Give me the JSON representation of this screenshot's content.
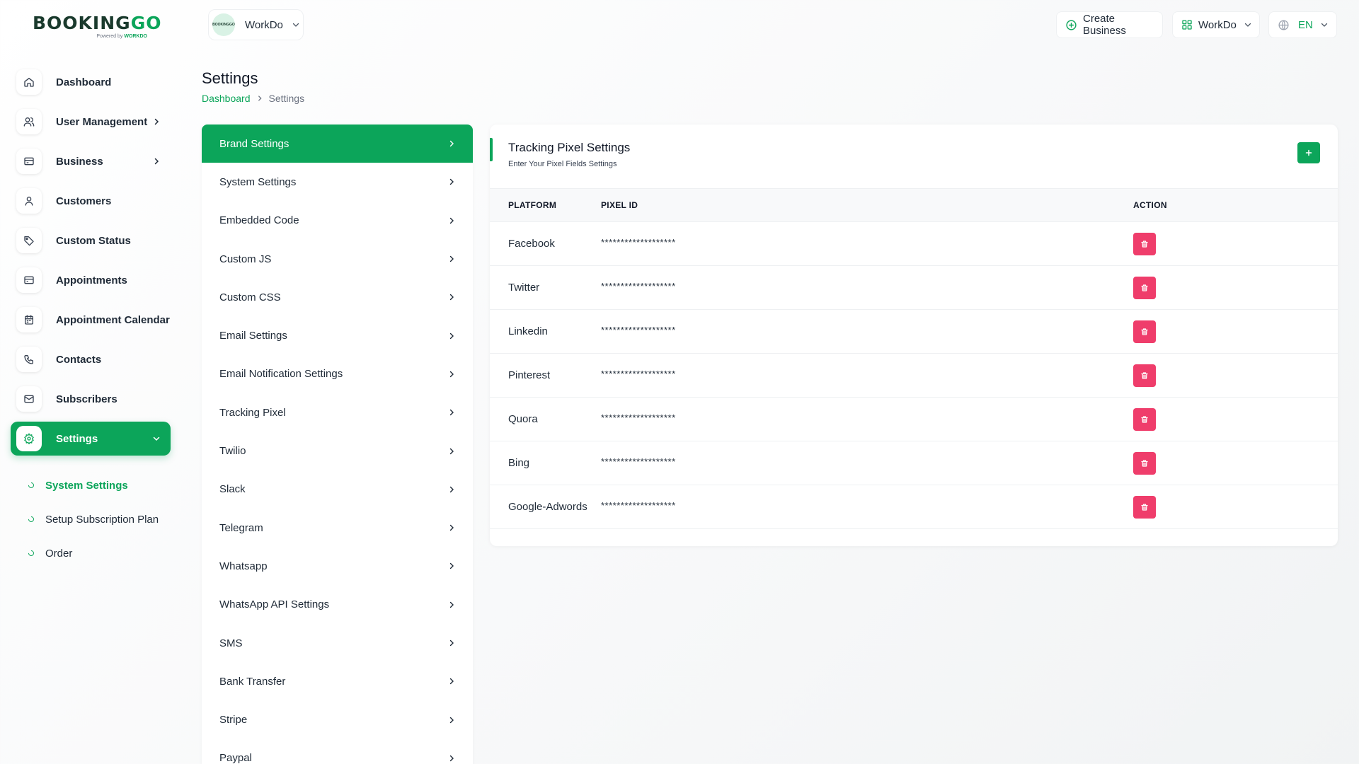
{
  "brand": {
    "logo_main": "BOOKING",
    "logo_accent": "GO",
    "logo_powered": "Powered by",
    "logo_powered_brand": "WORKDO"
  },
  "workspace": {
    "name": "WorkDo",
    "avatar_text": "BOOKINGGO"
  },
  "topbar": {
    "create_label": "Create Business",
    "workspace_label": "WorkDo",
    "language": "EN"
  },
  "sidebar": {
    "items": [
      {
        "label": "Dashboard",
        "icon": "home-icon"
      },
      {
        "label": "User Management",
        "icon": "users-icon"
      },
      {
        "label": "Business",
        "icon": "business-icon"
      },
      {
        "label": "Customers",
        "icon": "user-icon"
      },
      {
        "label": "Custom Status",
        "icon": "tag-icon"
      },
      {
        "label": "Appointments",
        "icon": "card-icon"
      },
      {
        "label": "Appointment Calendar",
        "icon": "calendar-icon"
      },
      {
        "label": "Contacts",
        "icon": "phone-icon"
      },
      {
        "label": "Subscribers",
        "icon": "mail-icon"
      },
      {
        "label": "Settings",
        "icon": "gear-icon"
      }
    ],
    "sub_items": [
      {
        "label": "System Settings"
      },
      {
        "label": "Setup Subscription Plan"
      },
      {
        "label": "Order"
      }
    ]
  },
  "page": {
    "title": "Settings",
    "breadcrumb_home": "Dashboard",
    "breadcrumb_current": "Settings"
  },
  "settings_menu": [
    "Brand Settings",
    "System Settings",
    "Embedded Code",
    "Custom JS",
    "Custom CSS",
    "Email Settings",
    "Email Notification Settings",
    "Tracking Pixel",
    "Twilio",
    "Slack",
    "Telegram",
    "Whatsapp",
    "WhatsApp API Settings",
    "SMS",
    "Bank Transfer",
    "Stripe",
    "Paypal"
  ],
  "tracking_card": {
    "title": "Tracking Pixel Settings",
    "subtitle": "Enter Your Pixel Fields Settings",
    "columns": {
      "platform": "PLATFORM",
      "pixel_id": "PIXEL ID",
      "action": "ACTION"
    },
    "rows": [
      {
        "platform": "Facebook",
        "pixel_id": "*******************"
      },
      {
        "platform": "Twitter",
        "pixel_id": "*******************"
      },
      {
        "platform": "Linkedin",
        "pixel_id": "*******************"
      },
      {
        "platform": "Pinterest",
        "pixel_id": "*******************"
      },
      {
        "platform": "Quora",
        "pixel_id": "*******************"
      },
      {
        "platform": "Bing",
        "pixel_id": "*******************"
      },
      {
        "platform": "Google-Adwords",
        "pixel_id": "*******************"
      }
    ]
  },
  "colors": {
    "accent": "#0ca55a",
    "danger": "#ef3d6b",
    "text": "#1f2a37"
  }
}
